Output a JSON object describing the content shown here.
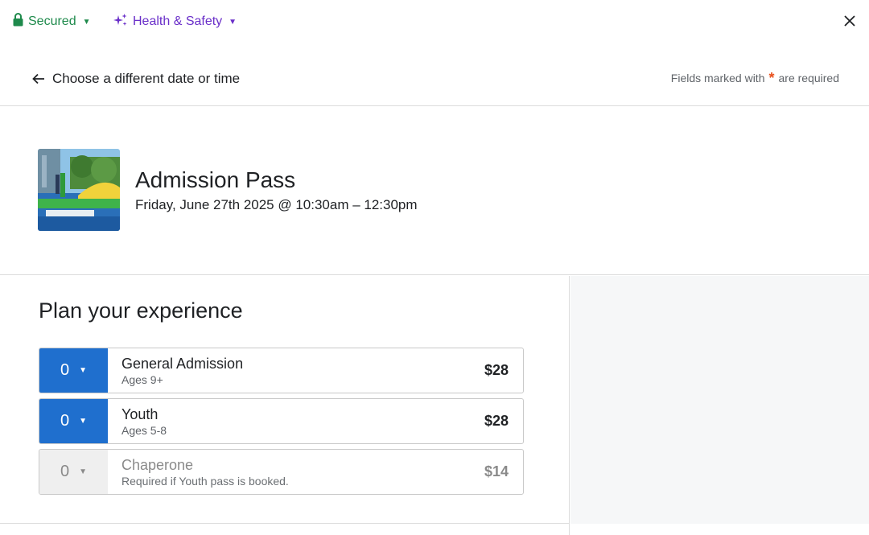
{
  "topbar": {
    "secured_label": "Secured",
    "health_label": "Health & Safety",
    "colors": {
      "secured": "#1f8a4c",
      "health": "#6a2fc9"
    }
  },
  "nav": {
    "back_label": "Choose a different date or time",
    "required_prefix": "Fields marked with",
    "required_asterisk": "*",
    "required_suffix": "are required"
  },
  "event": {
    "title": "Admission Pass",
    "datetime": "Friday, June 27th 2025 @ 10:30am – 12:30pm"
  },
  "plan": {
    "title": "Plan your experience",
    "tickets": [
      {
        "qty": "0",
        "name": "General Admission",
        "sub": "Ages 9+",
        "price": "$28",
        "enabled": true
      },
      {
        "qty": "0",
        "name": "Youth",
        "sub": "Ages 5-8",
        "price": "$28",
        "enabled": true
      },
      {
        "qty": "0",
        "name": "Chaperone",
        "sub": "Required if Youth pass is booked.",
        "price": "$14",
        "enabled": false
      }
    ]
  },
  "colors": {
    "accent": "#1f6fce",
    "asterisk": "#e8501c"
  }
}
